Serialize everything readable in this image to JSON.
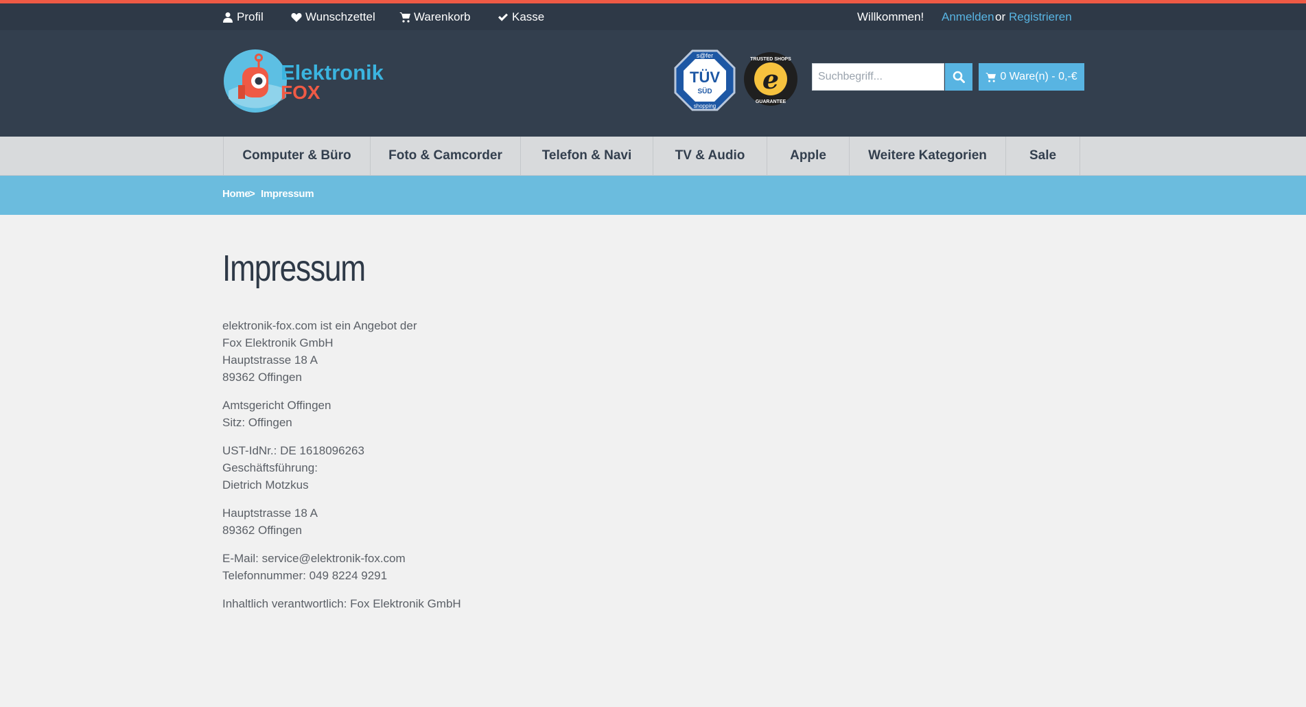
{
  "topbar": {
    "links": [
      {
        "label": "Profil",
        "icon": "user-icon"
      },
      {
        "label": "Wunschzettel",
        "icon": "heart-icon"
      },
      {
        "label": "Warenkorb",
        "icon": "cart-icon"
      },
      {
        "label": "Kasse",
        "icon": "check-icon"
      }
    ],
    "welcome": "Willkommen!",
    "login": "Anmelden",
    "or": "or",
    "register": "Registrieren"
  },
  "header": {
    "logo_top": "Elektronik",
    "logo_bottom": "FOX",
    "tuv_top": "s@fer",
    "tuv_main": "TÜV",
    "tuv_sub": "SÜD",
    "tuv_bottom": "shopping",
    "ts_letter": "e",
    "ts_top": "TRUSTED SHOPS",
    "ts_bottom": "GUARANTEE",
    "search_placeholder": "Suchbegriff...",
    "cart_label": "0 Ware(n) - 0,-€"
  },
  "nav": {
    "items": [
      "Computer & Büro",
      "Foto & Camcorder",
      "Telefon & Navi",
      "TV & Audio",
      "Apple",
      "Weitere Kategorien",
      "Sale"
    ]
  },
  "breadcrumb": {
    "home": "Home",
    "separator": ">",
    "current": "Impressum"
  },
  "page": {
    "title": "Impressum",
    "blocks": [
      [
        "elektronik-fox.com ist ein Angebot der",
        "Fox Elektronik GmbH",
        "Hauptstrasse 18 A",
        "89362 Offingen"
      ],
      [
        "Amtsgericht Offingen",
        "Sitz: Offingen"
      ],
      [
        "UST-IdNr.: DE 1618096263",
        "Geschäftsführung:",
        "Dietrich Motzkus"
      ],
      [
        "Hauptstrasse 18 A",
        "89362 Offingen"
      ],
      [
        "E-Mail: service@elektronik-fox.com",
        "Telefonnummer: 049 8224 9291"
      ],
      [
        "Inhaltlich verantwortlich: Fox Elektronik GmbH"
      ]
    ]
  },
  "colors": {
    "accent_red": "#ef5a45",
    "dark_header": "#333f4e",
    "topbar": "#2e3947",
    "blue": "#58b4e2",
    "breadcrumb_bar": "#6bbcde",
    "nav_bg": "#d8dadc"
  }
}
